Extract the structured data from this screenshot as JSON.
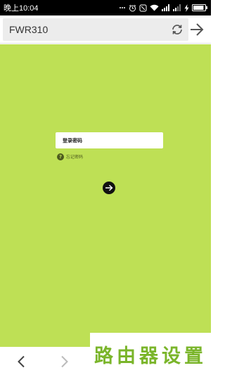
{
  "status_bar": {
    "time": "晚上10:04",
    "battery_level": 0.9,
    "icons": [
      "notification-icon",
      "alarm-icon",
      "silent-icon",
      "wifi-icon",
      "signal-icon",
      "signal-icon",
      "charging-battery-icon"
    ]
  },
  "address_bar": {
    "url": "FWR310"
  },
  "login": {
    "password_placeholder": "登录密码",
    "forgot_label": "忘记密码",
    "help_symbol": "?"
  },
  "watermark": {
    "text": "路由器设置"
  },
  "colors": {
    "page_background": "#bee055",
    "watermark": "#7ab52a",
    "submit_button": "#111111"
  }
}
